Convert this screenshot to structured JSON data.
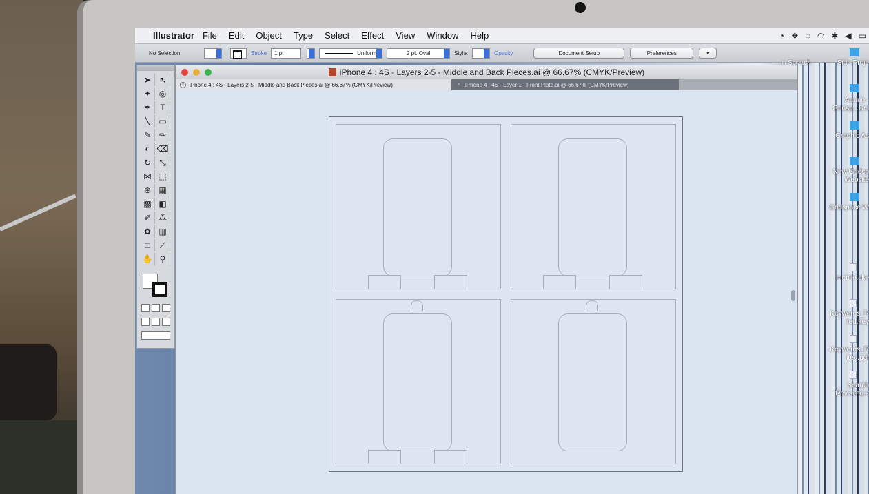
{
  "menubar": {
    "apple_glyph": "",
    "app_name": "Illustrator",
    "menus": [
      "File",
      "Edit",
      "Object",
      "Type",
      "Select",
      "Effect",
      "View",
      "Window",
      "Help"
    ]
  },
  "controlbar": {
    "selection_label": "No Selection",
    "stroke_label": "Stroke",
    "stroke_weight": "1 pt",
    "profile": "Uniform",
    "brush": "2 pt. Oval",
    "style_label": "Style:",
    "opacity_label": "Opacity",
    "document_setup": "Document Setup",
    "preferences": "Preferences"
  },
  "document": {
    "window_title": "iPhone 4 : 4S - Layers 2-5 - Middle and Back Pieces.ai @ 66.67% (CMYK/Preview)",
    "tabs": [
      {
        "label": "iPhone 4 : 4S - Layers 2-5 - Middle and Back Pieces.ai @ 66.67% (CMYK/Preview)",
        "active": true
      },
      {
        "label": "iPhone 4 : 4S - Layer 1 - Front Plate.ai @ 66.67% (CMYK/Preview)",
        "active": false
      }
    ]
  },
  "desktop": {
    "icons": [
      {
        "label": "Side Proje",
        "kind": "folder"
      },
      {
        "label": "Ammo - Gridsp...Del",
        "kind": "folder"
      },
      {
        "label": "Graphic As",
        "kind": "folder"
      },
      {
        "label": "New Gridsp Website",
        "kind": "folder"
      },
      {
        "label": "Gridspace W",
        "kind": "folder"
      },
      {
        "label": "mobile.ske",
        "kind": "file"
      },
      {
        "label": "Keywords_R ted.key",
        "kind": "file"
      },
      {
        "label": "Keywords_R ited.pdf",
        "kind": "file"
      },
      {
        "label": "Search Revisited.k",
        "kind": "file"
      }
    ],
    "partial_label": "n Scratch"
  },
  "colors": {
    "accent": "#3c6fd6",
    "close": "#e2463e",
    "minimize": "#e7b03a",
    "zoom": "#38b34a"
  }
}
